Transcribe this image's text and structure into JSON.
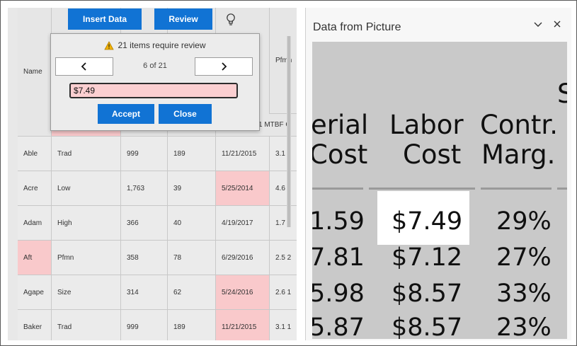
{
  "toolbar": {
    "insert_label": "Insert Data",
    "review_label": "Review",
    "bulb_icon": "lightbulb-icon"
  },
  "grid": {
    "name_header": "Name",
    "pfmn_header": "Pfmn",
    "mtbf_header": "1 MTBF C",
    "rows": [
      {
        "c1": "Able",
        "c2": "Trad",
        "c3": "999",
        "c4": "189",
        "c5": "11/21/2015",
        "c6": "3.1 1"
      },
      {
        "c1": "Acre",
        "c2": "Low",
        "c3": "1,763",
        "c4": "39",
        "c5": "5/25/2014",
        "c6": "4.6 1"
      },
      {
        "c1": "Adam",
        "c2": "High",
        "c3": "366",
        "c4": "40",
        "c5": "4/19/2017",
        "c6": "1.7 2"
      },
      {
        "c1": "Aft",
        "c2": "Pfmn",
        "c3": "358",
        "c4": "78",
        "c5": "6/29/2016",
        "c6": "2.5 2"
      },
      {
        "c1": "Agape",
        "c2": "Size",
        "c3": "314",
        "c4": "62",
        "c5": "5/24/2016",
        "c6": "2.6 1"
      },
      {
        "c1": "Baker",
        "c2": "Trad",
        "c3": "999",
        "c4": "189",
        "c5": "11/21/2015",
        "c6": "3.1 1"
      }
    ]
  },
  "review_popup": {
    "message": "21 items require review",
    "prev_label": "‹",
    "next_label": "›",
    "counter": "6 of 21",
    "value": "$7.49",
    "accept_label": "Accept",
    "close_label": "Close"
  },
  "pane": {
    "title": "Data from Picture",
    "collapse_icon": "chevron-down-icon",
    "close_icon": "close-icon",
    "picture": {
      "headers": [
        {
          "line1": "erial",
          "line2": "Cost"
        },
        {
          "line1": "Labor",
          "line2": "Cost"
        },
        {
          "line1": "Contr.",
          "line2": "Marg."
        }
      ],
      "corner_letter": "S",
      "rows": [
        [
          "1.59",
          "$7.49",
          "29%"
        ],
        [
          "7.81",
          "$7.12",
          "27%"
        ],
        [
          "5.98",
          "$8.57",
          "33%"
        ],
        [
          "5.87",
          "$8.57",
          "23%"
        ]
      ]
    }
  },
  "colors": {
    "accent_blue": "#1173d4",
    "flag_pink": "#f9c9cb",
    "warning_yellow": "#f2b300"
  }
}
